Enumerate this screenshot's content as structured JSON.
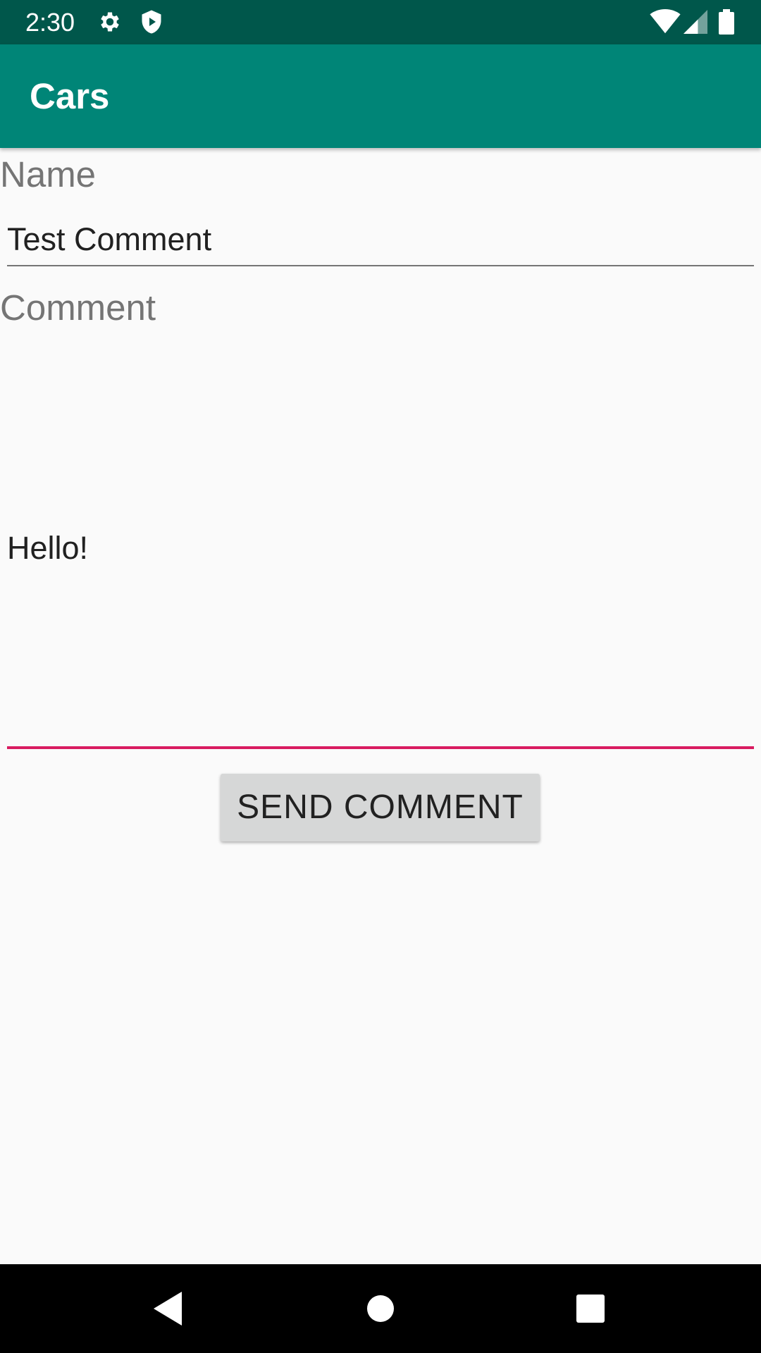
{
  "status_bar": {
    "time": "2:30",
    "icons": [
      "gear-icon",
      "shield-play-icon",
      "wifi-icon",
      "signal-icon",
      "battery-icon"
    ],
    "background": "#00574b"
  },
  "app_bar": {
    "title": "Cars",
    "background": "#008577"
  },
  "form": {
    "name_label": "Name",
    "name_value": "Test Comment",
    "comment_label": "Comment",
    "comment_value": "Hello!",
    "focus_color": "#d81b60",
    "send_button_label": "SEND COMMENT"
  },
  "nav_bar": {
    "icons": [
      "back-icon",
      "home-icon",
      "recents-icon"
    ]
  }
}
